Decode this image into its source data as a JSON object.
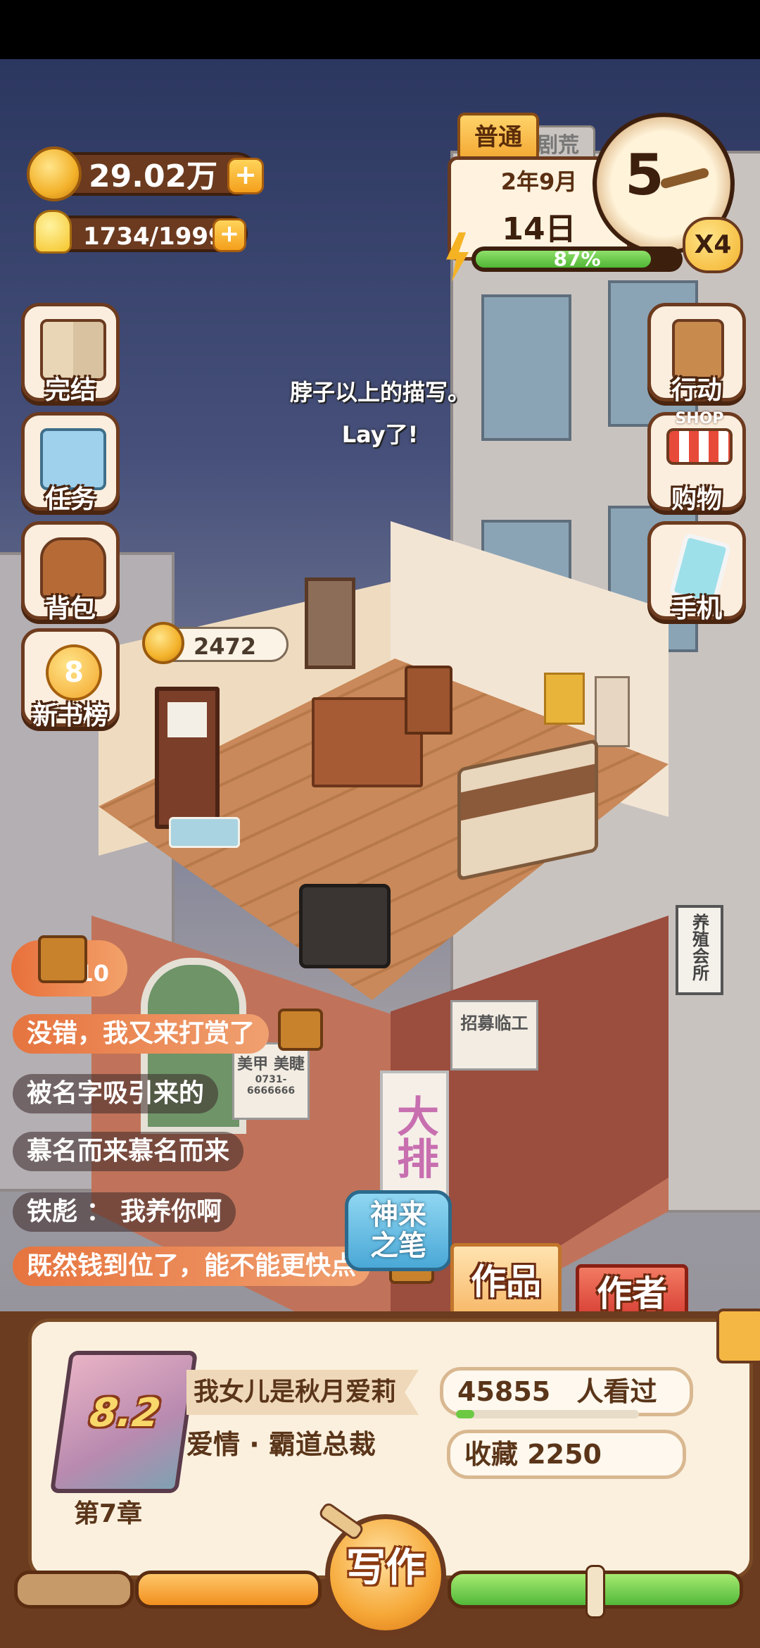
{
  "hud": {
    "currency": "29.02万",
    "energy": "1734/1999",
    "difficulty": "普通",
    "tab_behind": "剧荒",
    "date_month": "2年9月",
    "date_day": "14日",
    "hour": "5",
    "progress_percent": 87,
    "progress_label": "87%",
    "speed": "X4"
  },
  "left_menu": [
    {
      "label": "完结",
      "icon": "book-icon"
    },
    {
      "label": "任务",
      "icon": "clipboard-icon"
    },
    {
      "label": "背包",
      "icon": "bag-icon"
    },
    {
      "label": "新书榜",
      "icon": "medal-icon",
      "badge": "8"
    }
  ],
  "right_menu": [
    {
      "label": "行动",
      "icon": "door-icon"
    },
    {
      "label": "购物",
      "icon": "shop-icon",
      "sub": "SHOP"
    },
    {
      "label": "手机",
      "icon": "phone-icon"
    }
  ],
  "story_lines": [
    "脖子以上的描写。",
    "Lay了!"
  ],
  "room": {
    "coin_bubble": "2472",
    "sign_nail": "美甲 美睫",
    "sign_phone": "0731-6666666",
    "recruit": "招募临工",
    "vertical_sign": "大排",
    "shop_sign": "养殖会所"
  },
  "chest_count": "10",
  "chat": [
    "没错，我又来打赏了",
    "被名字吸引来的",
    "慕名而来慕名而来",
    "铁彪 ： 我养你啊",
    "既然钱到位了，能不能更快点"
  ],
  "event_button": "神来之笔",
  "tabs": {
    "works": "作品",
    "author": "作者"
  },
  "book": {
    "score": "8.2",
    "title": "我女儿是秋月爱莉",
    "genre": "爱情 · 霸道总裁",
    "chapter": "第7章"
  },
  "stats": {
    "views_num": "45855",
    "views_label": "人看过",
    "favorites": "收藏 2250"
  },
  "write_button": "写作",
  "colors": {
    "accent": "#f4a431",
    "brown": "#6b3a1f",
    "green": "#5cc93c",
    "red": "#d84a3a"
  }
}
